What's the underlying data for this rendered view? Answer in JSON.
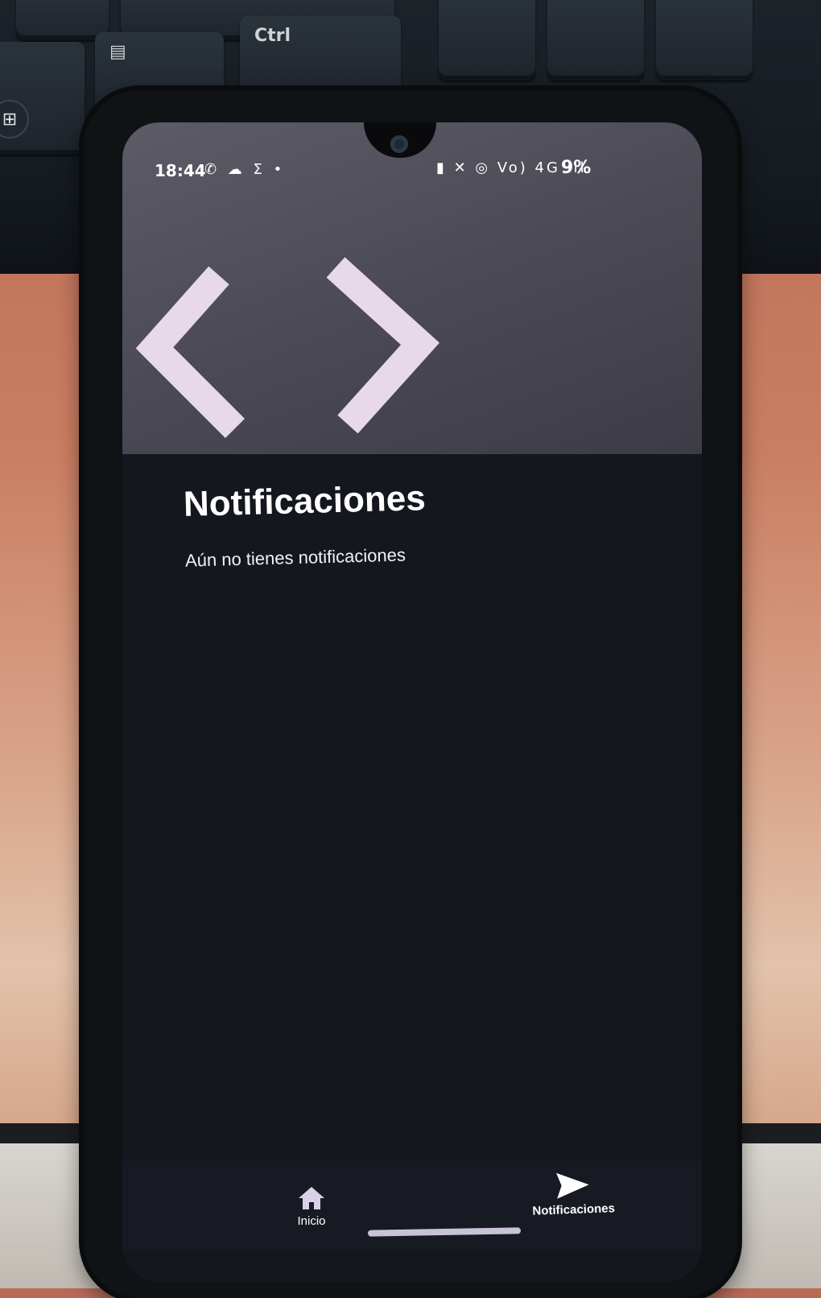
{
  "keyboard": {
    "ctrl_label": "Ctrl"
  },
  "status_bar": {
    "time": "18:44",
    "left_icons": "✆ ☁ Σ •",
    "right_icons": "▮ ✕ ◎ Vo) 4G ıll",
    "battery": "9%"
  },
  "app": {
    "logo_icon": "chevron-brackets-icon",
    "title": "Notificaciones",
    "empty_message": "Aún no tienes notificaciones",
    "accent_color": "#e7d9e8",
    "banner_color": "#4a4853",
    "background_color": "#15171f"
  },
  "bottom_nav": {
    "items": [
      {
        "label": "Inicio",
        "icon": "home-icon"
      },
      {
        "label": "Notificaciones",
        "icon": "send-icon"
      }
    ]
  }
}
